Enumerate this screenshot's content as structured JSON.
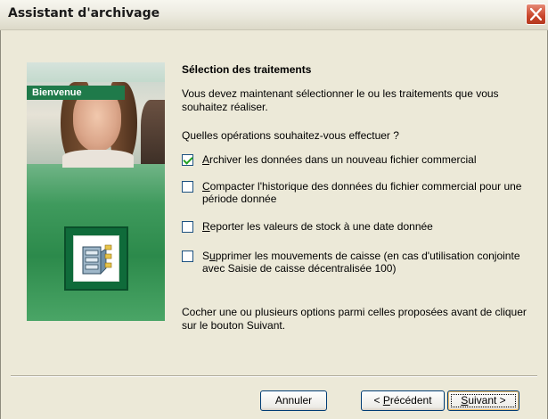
{
  "window": {
    "title": "Assistant d'archivage"
  },
  "side_panel": {
    "badge": "Bienvenue",
    "icon": "archive-wizard-icon"
  },
  "main": {
    "section_title": "Sélection des traitements",
    "intro": "Vous devez maintenant sélectionner le ou les traitements que vous souhaitez réaliser.",
    "question": "Quelles opérations souhaitez-vous effectuer ?",
    "options": [
      {
        "access_key": "A",
        "label_rest": "rchiver les données dans un nouveau fichier commercial",
        "checked": true
      },
      {
        "access_key": "C",
        "label_rest": "ompacter l'historique des données du fichier commercial pour une période donnée",
        "checked": false
      },
      {
        "access_key": "R",
        "label_rest": "eporter les valeurs de stock à une date donnée",
        "checked": false
      },
      {
        "label_before": "S",
        "access_key": "u",
        "label_rest": "pprimer les mouvements de caisse (en cas d'utilisation conjointe avec Saisie de caisse décentralisée 100)",
        "checked": false
      }
    ],
    "footer_note": "Cocher une ou plusieurs options parmi celles proposées avant de cliquer sur le bouton Suivant."
  },
  "buttons": {
    "cancel": "Annuler",
    "previous_prefix": "< ",
    "previous_key": "P",
    "previous_rest": "récédent",
    "next_key": "S",
    "next_rest": "uivant >"
  },
  "colors": {
    "dialog_bg": "#ece9d8",
    "accent_green": "#1f7a4a",
    "close_red": "#c9452a",
    "check_green": "#21a121"
  }
}
